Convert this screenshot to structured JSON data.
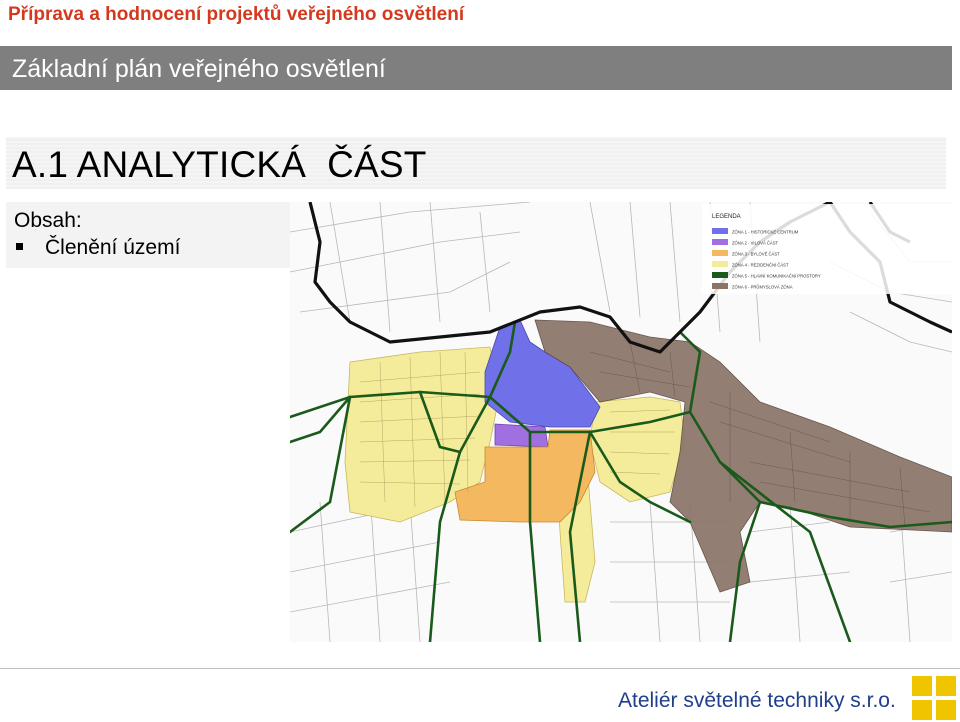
{
  "header": {
    "title": "Příprava a hodnocení projektů veřejného osvětlení"
  },
  "section": {
    "title": "Základní plán veřejného osvětlení"
  },
  "heading": {
    "title": "A.1 ANALYTICKÁ  ČÁST"
  },
  "content": {
    "label": "Obsah:",
    "items": [
      "Členění území"
    ]
  },
  "map": {
    "legend_title": "LEGENDA",
    "legend": [
      {
        "label": "ZÓNA 1 - HISTORICKÉ CENTRUM",
        "color": "#7070e8"
      },
      {
        "label": "ZÓNA 2 - VILOVÁ ČÁST",
        "color": "#a070e0"
      },
      {
        "label": "ZÓNA 3 - BYLOVÉ ČÁST",
        "color": "#f4b860"
      },
      {
        "label": "ZÓNA 4 - REZIDENČNÍ ČÁST",
        "color": "#f4ec9a"
      },
      {
        "label": "ZÓNA 5 - HLAVNÍ KOMUNIKAČNÍ PROSTORY",
        "color": "#1a5a1a"
      },
      {
        "label": "ZÓNA 6 - PRŮMYSLOVÁ ZÓNA",
        "color": "#8b7468"
      }
    ]
  },
  "footer": {
    "company": "Ateliér světelné techniky s.r.o."
  },
  "colors": {
    "title_red": "#d4391e",
    "bar_gray": "#7f7f7f",
    "footer_blue": "#1f3e8c",
    "logo_yellow": "#f0c500"
  }
}
